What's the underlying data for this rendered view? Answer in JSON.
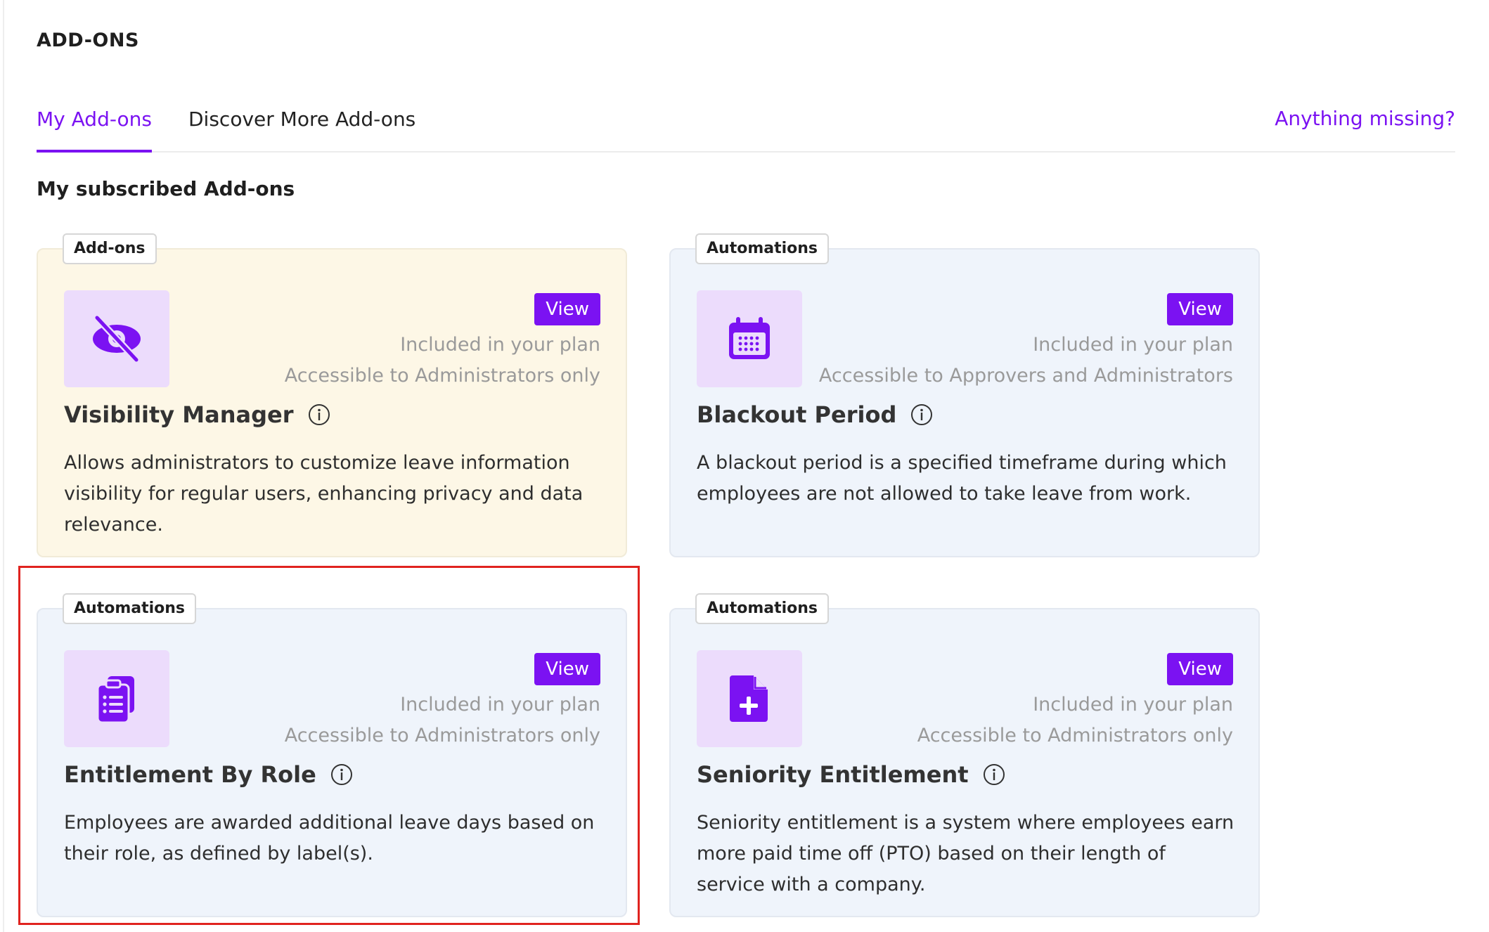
{
  "page": {
    "title": "ADD-ONS"
  },
  "tabs": [
    {
      "label": "My Add-ons",
      "active": true
    },
    {
      "label": "Discover More Add-ons",
      "active": false
    }
  ],
  "missing_link": "Anything missing?",
  "section_title": "My subscribed Add-ons",
  "colors": {
    "accent": "#7b12f2",
    "highlight": "#e0231f",
    "card_blue": "#eff4fb",
    "card_yellow": "#fdf7e6",
    "icon_bg": "#ecdcfc"
  },
  "cards": [
    {
      "badge": "Add-ons",
      "icon": "eye-off-icon",
      "view_label": "View",
      "plan_status": "Included in your plan",
      "access": "Accessible to Administrators only",
      "title": "Visibility Manager",
      "description": "Allows administrators to customize leave information visibility for regular users, enhancing privacy and data relevance."
    },
    {
      "badge": "Automations",
      "icon": "calendar-icon",
      "view_label": "View",
      "plan_status": "Included in your plan",
      "access": "Accessible to Approvers and Administrators",
      "title": "Blackout Period",
      "description": "A blackout period is a specified timeframe during which employees are not allowed to take leave from work."
    },
    {
      "badge": "Automations",
      "icon": "clipboard-list-icon",
      "view_label": "View",
      "plan_status": "Included in your plan",
      "access": "Accessible to Administrators only",
      "title": "Entitlement By Role",
      "description": "Employees are awarded additional leave days based on their role, as defined by label(s)."
    },
    {
      "badge": "Automations",
      "icon": "file-plus-icon",
      "view_label": "View",
      "plan_status": "Included in your plan",
      "access": "Accessible to Administrators only",
      "title": "Seniority Entitlement",
      "description": "Seniority entitlement is a system where employees earn more paid time off (PTO) based on their length of service with a company."
    }
  ]
}
